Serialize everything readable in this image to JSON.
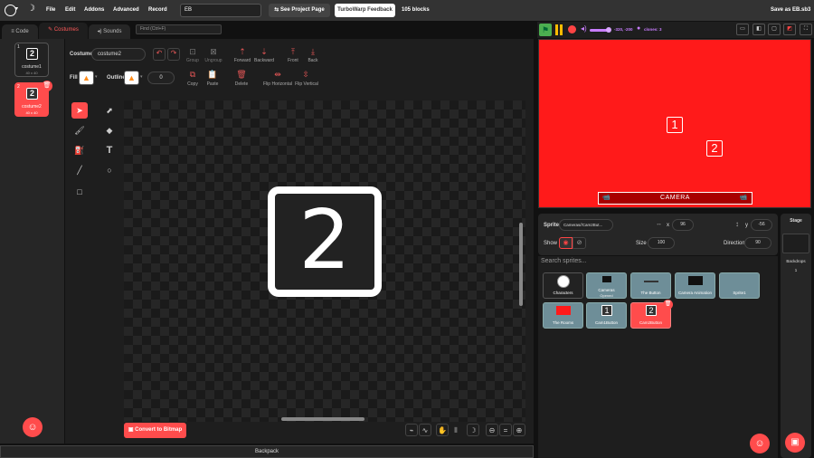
{
  "menu": {
    "file": "File",
    "edit": "Edit",
    "addons": "Addons",
    "advanced": "Advanced",
    "record": "Record",
    "project_title": "EB",
    "see_project": "See Project Page",
    "feedback": "TurboWarp Feedback",
    "blocks": "105 blocks",
    "save": "Save as EB.sb3"
  },
  "tabs": {
    "code": "Code",
    "costumes": "Costumes",
    "sounds": "Sounds",
    "find": "Find (Ctrl+F)"
  },
  "costumes": [
    {
      "num": "1",
      "name": "costume1",
      "size": "40 x 40",
      "glyph": "2"
    },
    {
      "num": "2",
      "name": "costume2",
      "size": "40 x 40",
      "glyph": "2"
    }
  ],
  "editor": {
    "costume_label": "Costume",
    "costume_name": "costume2",
    "fill_label": "Fill",
    "outline_label": "Outline",
    "outline_width": "0",
    "group": "Group",
    "ungroup": "Ungroup",
    "forward": "Forward",
    "backward": "Backward",
    "front": "Front",
    "back": "Back",
    "copy": "Copy",
    "paste": "Paste",
    "delete": "Delete",
    "flip_h": "Flip Horizontal",
    "flip_v": "Flip Vertical",
    "canvas_glyph": "2",
    "convert": "Convert to Bitmap",
    "zoom_eq": "="
  },
  "stage": {
    "coords": "-320, -200",
    "clones": "clones: 3",
    "box1": "1",
    "box2": "2",
    "camera": "CAMERA",
    "accent": "#ff1a1a"
  },
  "sprite_info": {
    "sprite_label": "Sprite",
    "sprite_name": "Cameras//Cam2But...",
    "x_label": "x",
    "x": "96",
    "y_label": "y",
    "y": "-56",
    "show_label": "Show",
    "size_label": "Size",
    "size": "100",
    "direction_label": "Direction",
    "direction": "90",
    "search": "Search sprites..."
  },
  "sprites": [
    {
      "name": "Characters",
      "glyph": ""
    },
    {
      "name": "Cameras",
      "sub": "Opened",
      "glyph": ""
    },
    {
      "name": "The Button",
      "glyph": ""
    },
    {
      "name": "Camera Animation",
      "glyph": ""
    },
    {
      "name": "Sprite1",
      "glyph": ""
    },
    {
      "name": "The Rooms",
      "glyph": ""
    },
    {
      "name": "Cam1Button",
      "glyph": "1"
    },
    {
      "name": "Cam2Button",
      "glyph": "2"
    }
  ],
  "stage_panel": {
    "title": "Stage",
    "backdrops": "Backdrops",
    "count": "1"
  },
  "backpack": "Backpack"
}
